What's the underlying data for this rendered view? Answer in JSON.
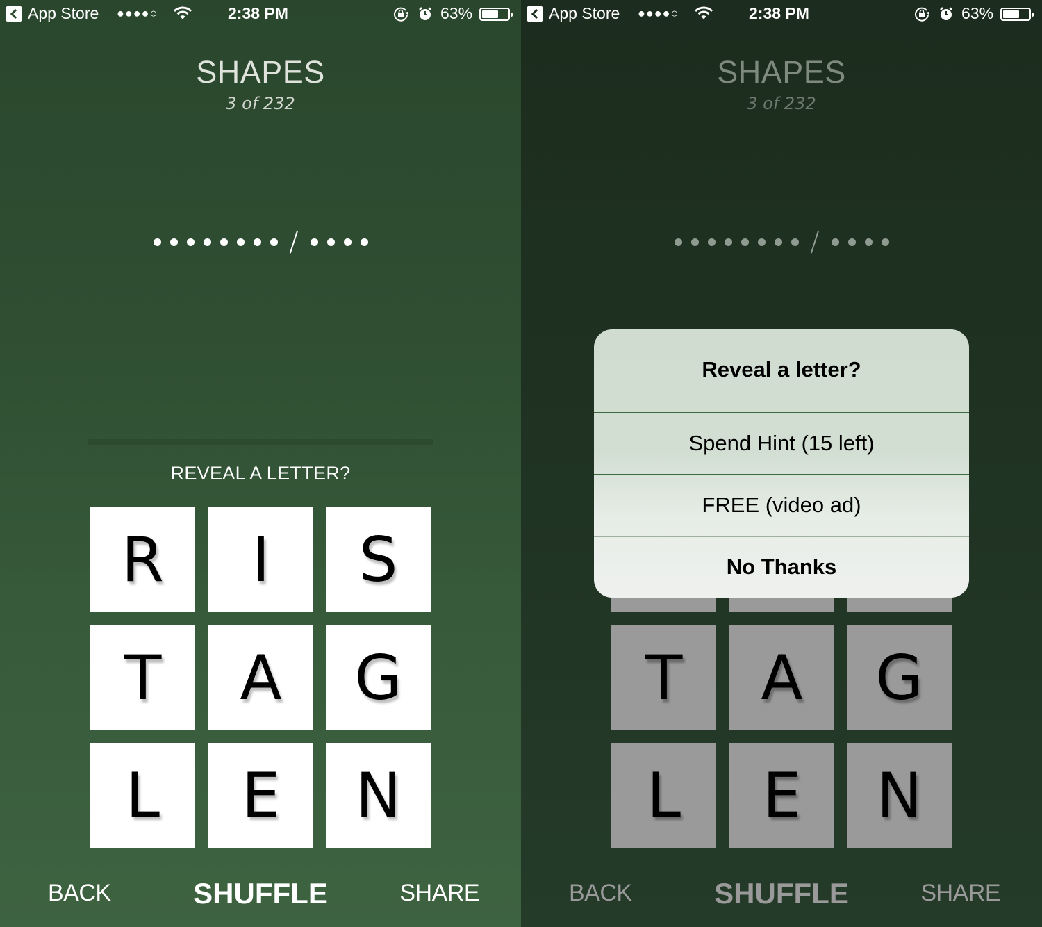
{
  "status_bar": {
    "back_app": "App Store",
    "signal": "●●●●○",
    "time": "2:38 PM",
    "battery_percent": "63%",
    "battery_level": 0.63,
    "icons": [
      "back-arrow-icon",
      "signal-icon",
      "wifi-icon",
      "rotation-lock-icon",
      "alarm-icon",
      "battery-icon"
    ]
  },
  "header": {
    "title": "SHAPES",
    "progress": "3 of 232"
  },
  "answer": {
    "word1_length": 8,
    "word2_length": 4,
    "separator": "/"
  },
  "hint": {
    "label": "REVEAL A LETTER?"
  },
  "tiles": [
    "R",
    "I",
    "S",
    "T",
    "A",
    "G",
    "L",
    "E",
    "N"
  ],
  "bottom_nav": {
    "back": "BACK",
    "shuffle": "SHUFFLE",
    "share": "SHARE"
  },
  "alert": {
    "title": "Reveal a letter?",
    "buttons": [
      {
        "label": "Spend Hint (15 left)"
      },
      {
        "label": "FREE (video ad)"
      },
      {
        "label": "No Thanks"
      }
    ]
  },
  "colors": {
    "bg_top": "#2a472d",
    "bg_bottom": "#3e6341",
    "dim_bg_top": "#1c2c1e",
    "tile": "#ffffff",
    "tile_dimmed": "#9a9a9a",
    "alert_bg": "#d2ded2"
  }
}
